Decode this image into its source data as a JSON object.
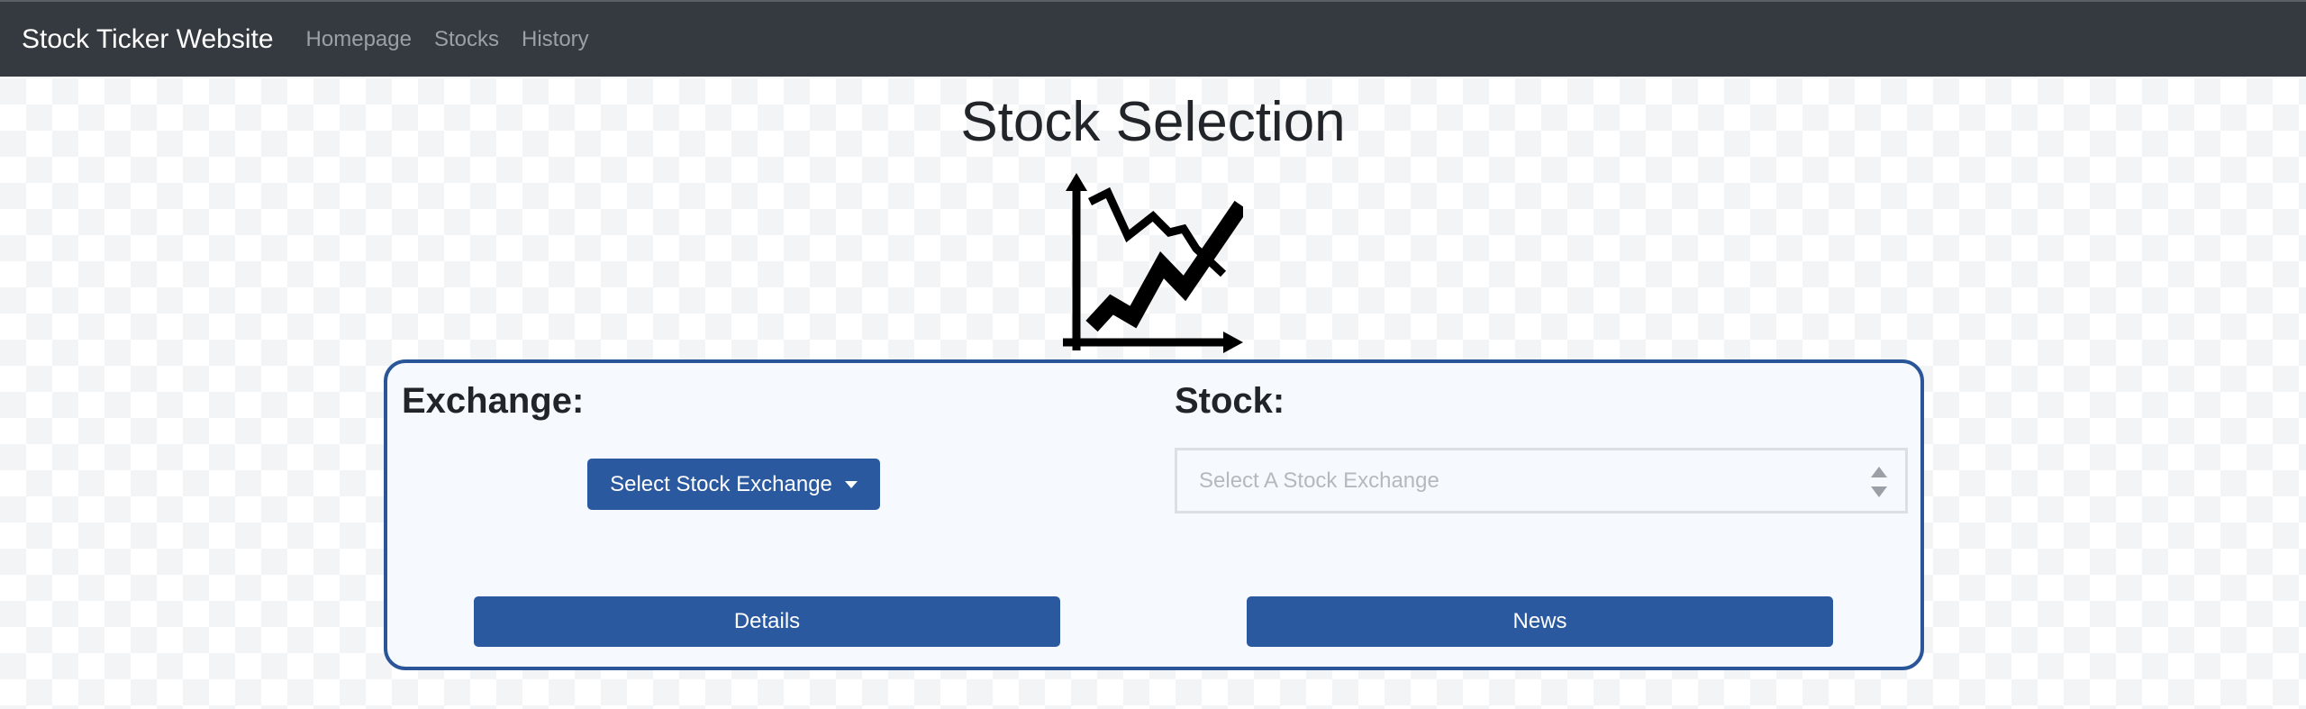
{
  "navbar": {
    "brand": "Stock Ticker Website",
    "links": [
      "Homepage",
      "Stocks",
      "History"
    ]
  },
  "page": {
    "title": "Stock Selection",
    "icon": "stock-chart-icon"
  },
  "panel": {
    "exchange_label": "Exchange:",
    "exchange_dropdown_label": "Select Stock Exchange",
    "stock_label": "Stock:",
    "stock_select_placeholder": "Select A Stock Exchange",
    "details_button": "Details",
    "news_button": "News"
  },
  "colors": {
    "navbar_bg": "#343a40",
    "accent": "#2a59a0",
    "panel_border": "#2a5699",
    "panel_bg": "#f6f9fd"
  }
}
